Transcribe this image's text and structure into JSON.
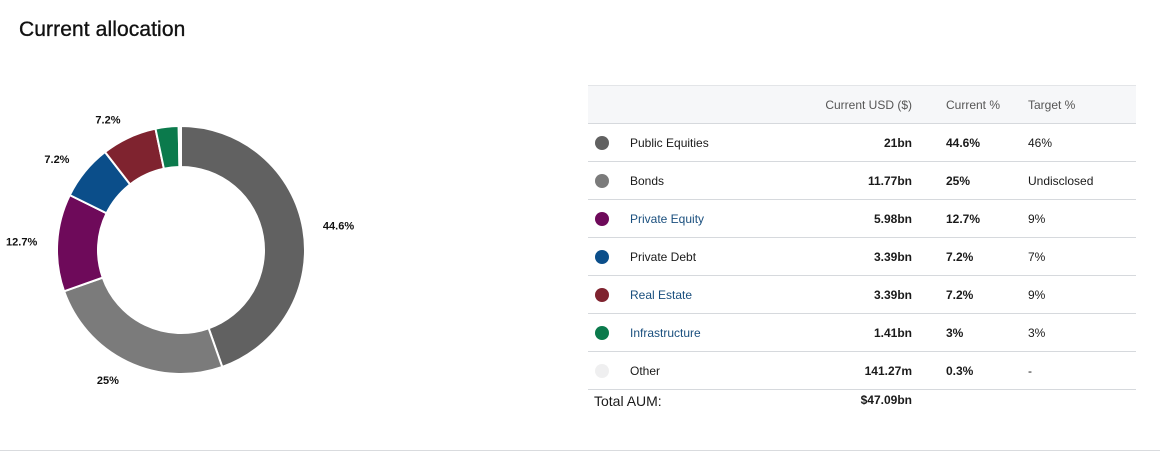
{
  "page": {
    "title": "Current allocation"
  },
  "chart_data": {
    "type": "pie",
    "donut": true,
    "slices": [
      {
        "label": "Public Equities",
        "value": 44.6,
        "display": "44.6%",
        "color": "#616161"
      },
      {
        "label": "Bonds",
        "value": 25,
        "display": "25%",
        "color": "#7b7b7b"
      },
      {
        "label": "Private Equity",
        "value": 12.7,
        "display": "12.7%",
        "color": "#6e0a5a"
      },
      {
        "label": "Private Debt",
        "value": 7.2,
        "display": "7.2%",
        "color": "#0b4e8a"
      },
      {
        "label": "Real Estate",
        "value": 7.2,
        "display": "7.2%",
        "color": "#7f232f"
      },
      {
        "label": "Infrastructure",
        "value": 3,
        "display": "",
        "color": "#0b7a4c"
      },
      {
        "label": "Other",
        "value": 0.3,
        "display": "",
        "color": "#efeff0"
      }
    ]
  },
  "table": {
    "headers": {
      "usd": "Current USD ($)",
      "current": "Current %",
      "target": "Target %"
    },
    "rows": [
      {
        "name": "Public Equities",
        "usd": "21bn",
        "current": "44.6%",
        "target": "46%",
        "color": "#616161",
        "link": false
      },
      {
        "name": "Bonds",
        "usd": "11.77bn",
        "current": "25%",
        "target": "Undisclosed",
        "color": "#7b7b7b",
        "link": false
      },
      {
        "name": "Private Equity",
        "usd": "5.98bn",
        "current": "12.7%",
        "target": "9%",
        "color": "#6e0a5a",
        "link": true
      },
      {
        "name": "Private Debt",
        "usd": "3.39bn",
        "current": "7.2%",
        "target": "7%",
        "color": "#0b4e8a",
        "link": false
      },
      {
        "name": "Real Estate",
        "usd": "3.39bn",
        "current": "7.2%",
        "target": "9%",
        "color": "#7f232f",
        "link": true
      },
      {
        "name": "Infrastructure",
        "usd": "1.41bn",
        "current": "3%",
        "target": "3%",
        "color": "#0b7a4c",
        "link": true
      },
      {
        "name": "Other",
        "usd": "141.27m",
        "current": "0.3%",
        "target": "-",
        "color": "#efeff0",
        "link": false
      }
    ],
    "total": {
      "label": "Total AUM:",
      "value": "$47.09bn"
    }
  }
}
